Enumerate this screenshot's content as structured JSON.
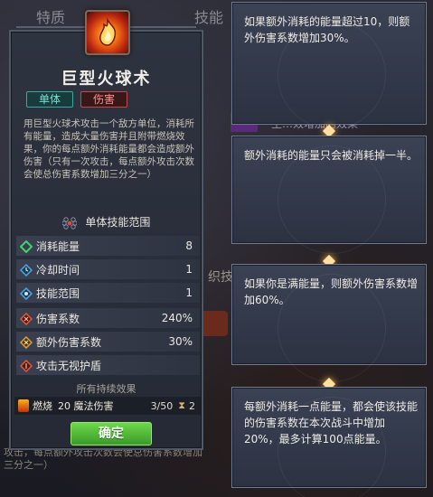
{
  "background": {
    "tab_left": "特质",
    "tab_right": "技能",
    "side_label": "织技",
    "effect_hint": "生…效增加的效果",
    "bottom_hint": "攻击，每点额外攻击次数会使总伤害系数增加三分之一）"
  },
  "skill": {
    "name": "巨型火球术",
    "tags": [
      "单体",
      "伤害"
    ],
    "description": "用巨型火球术攻击一个敌方单位，消耗所有能量，造成大量伤害并且附带燃烧效果，你的每点额外消耗能量都会造成额外伤害（只有一次攻击，每点额外攻击次数会使总伤害系数增加三分之一）",
    "range_label": "单体技能范围",
    "stats": [
      {
        "label": "消耗能量",
        "value": "8",
        "icon": "energy-icon",
        "color": "#3fd46a"
      },
      {
        "label": "冷却时间",
        "value": "1",
        "icon": "cooldown-icon",
        "color": "#4aa8e0"
      },
      {
        "label": "技能范围",
        "value": "1",
        "icon": "range-icon",
        "color": "#4aa8e0"
      },
      {
        "label": "伤害系数",
        "value": "240%",
        "icon": "damage-icon",
        "color": "#e05a3a"
      },
      {
        "label": "额外伤害系数",
        "value": "30%",
        "icon": "extra-damage-icon",
        "color": "#e0a03a"
      },
      {
        "label": "攻击无视护盾",
        "value": "",
        "icon": "ignore-shield-icon",
        "color": "#e05a3a"
      }
    ],
    "effects_label": "所有持续效果",
    "effect": {
      "name": "燃烧",
      "detail": "20 魔法伤害",
      "stacks": "3/50",
      "turns": "2"
    },
    "confirm_label": "确定"
  },
  "tooltips": [
    "如果额外消耗的能量超过10，则额外伤害系数增加30%。",
    "额外消耗的能量只会被消耗掉一半。",
    "如果你是满能量，则额外伤害系数增加60%。",
    "每额外消耗一点能量，都会使该技能的伤害系数在本次战斗中增加20%，最多计算100点能量。"
  ]
}
